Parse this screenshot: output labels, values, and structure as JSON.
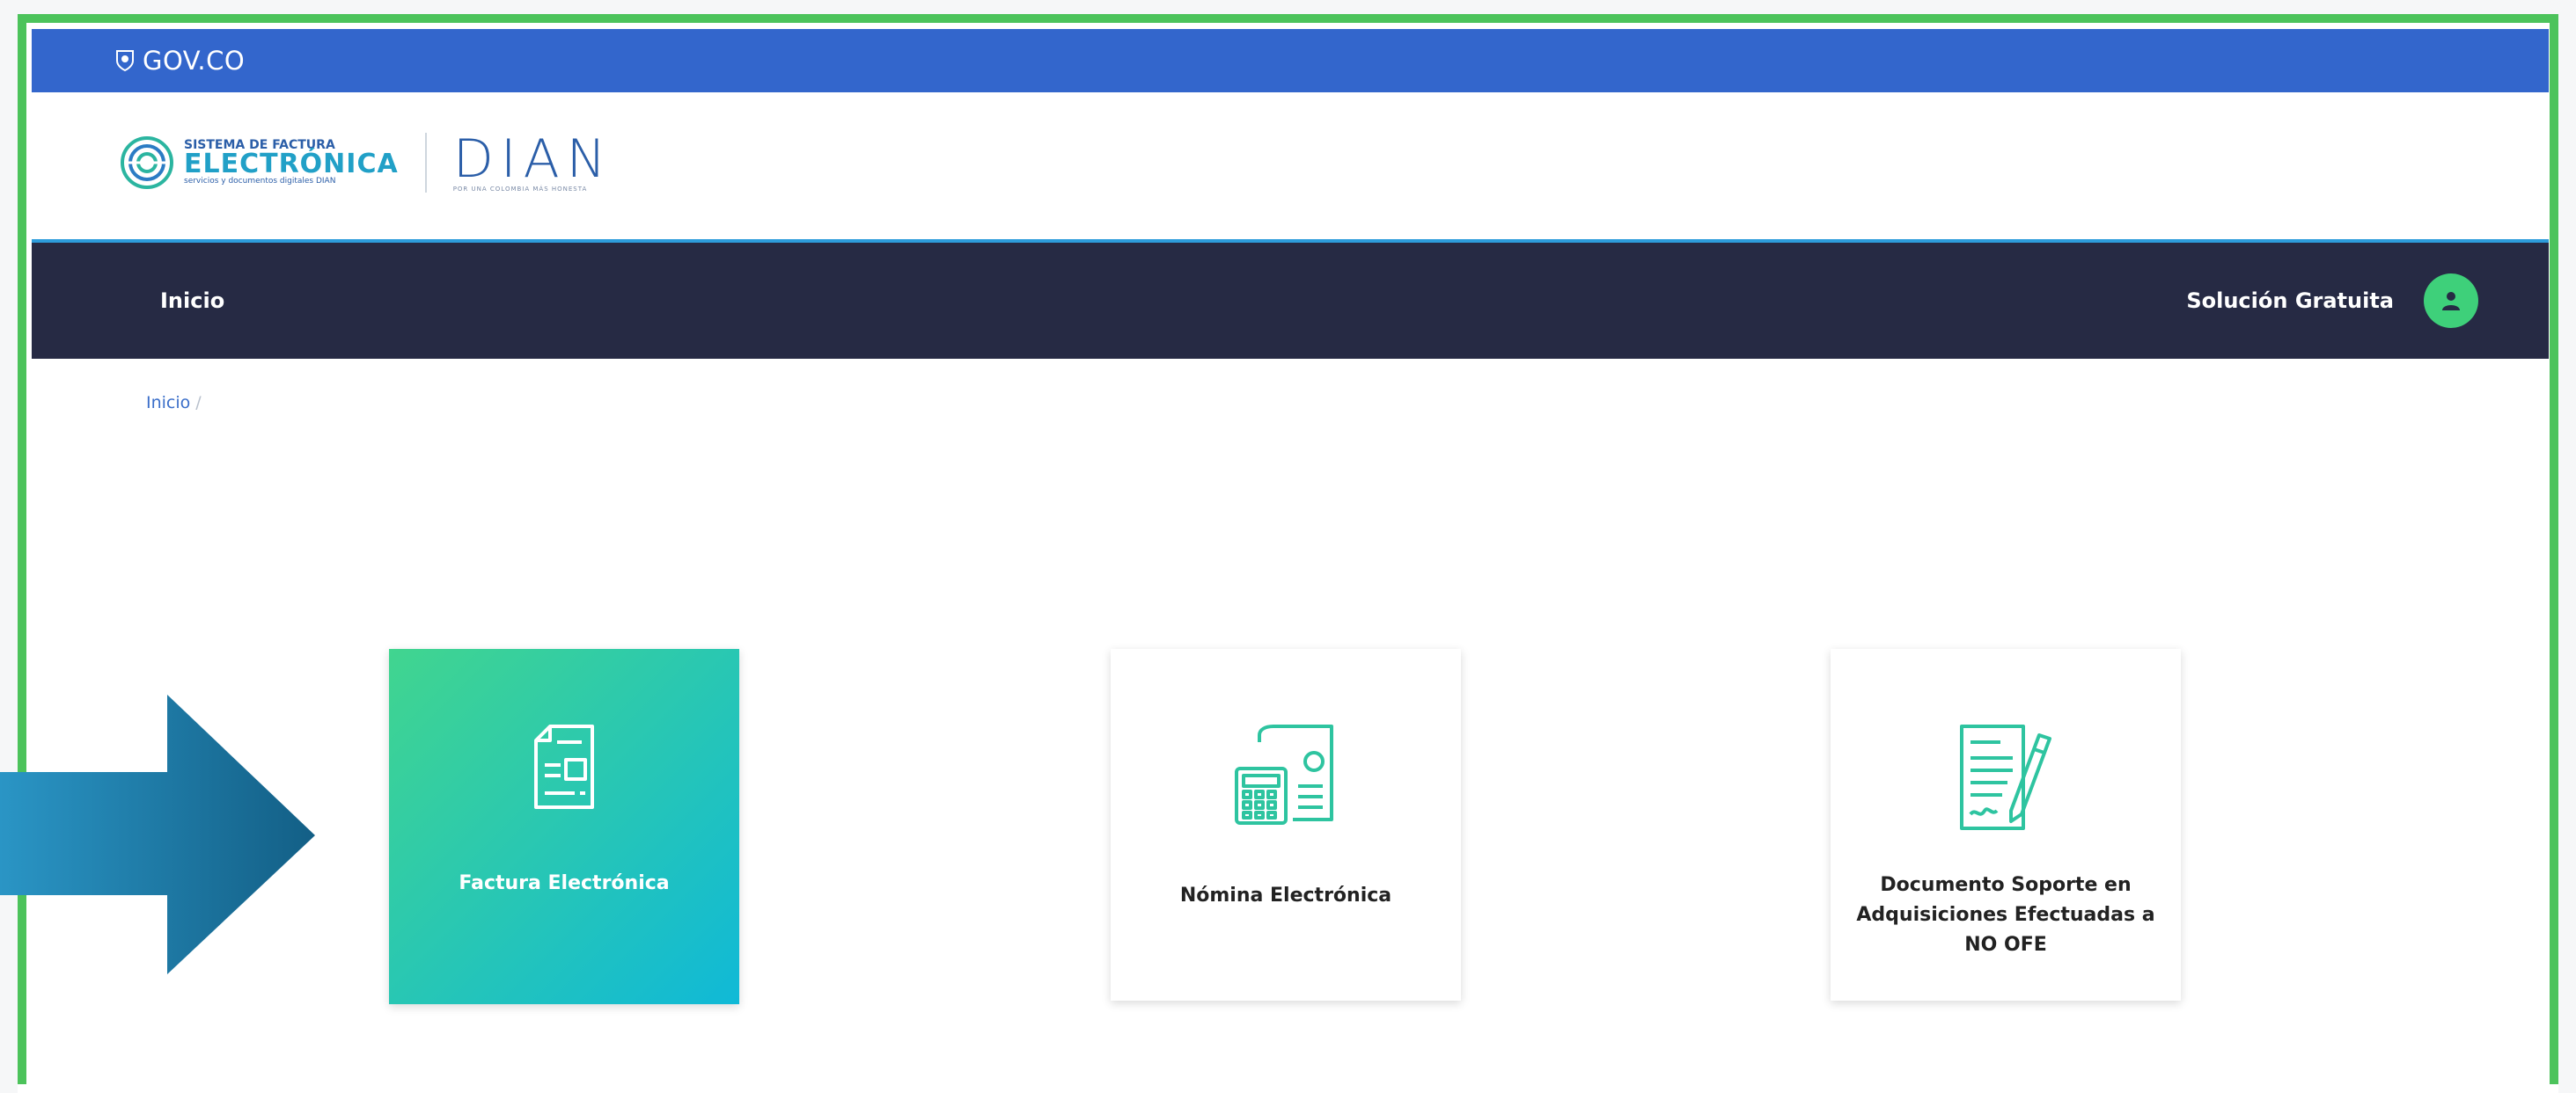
{
  "gov_bar": {
    "logo_text": "GOV.CO"
  },
  "header": {
    "sfe_logo": {
      "line1": "SISTEMA DE FACTURA",
      "line2": "ELECTRÓNICA",
      "line3": "servicios y documentos digitales DIAN"
    },
    "dian_logo": {
      "name": "DIAN",
      "tagline": "POR UNA COLOMBIA MÁS HONESTA"
    }
  },
  "nav": {
    "home_label": "Inicio",
    "right_label": "Solución Gratuita",
    "avatar_icon": "user-icon"
  },
  "breadcrumb": {
    "items": [
      "Inicio"
    ],
    "separator": "/"
  },
  "cards": [
    {
      "label": "Factura Electrónica",
      "icon": "invoice-icon",
      "selected": true
    },
    {
      "label": "Nómina Electrónica",
      "icon": "payroll-calculator-icon",
      "selected": false
    },
    {
      "label_lines": [
        "Documento Soporte en",
        "Adquisiciones Efectuadas a",
        "NO OFE"
      ],
      "icon": "signed-document-icon",
      "selected": false
    }
  ],
  "colors": {
    "gov_blue": "#3366cc",
    "nav_dark": "#262a44",
    "frame_green": "#4cc35b",
    "card_gradient_start": "#41d58f",
    "card_gradient_end": "#10b9d7",
    "icon_green": "#2ec4a0",
    "arrow_blue": "#1b6f97"
  }
}
